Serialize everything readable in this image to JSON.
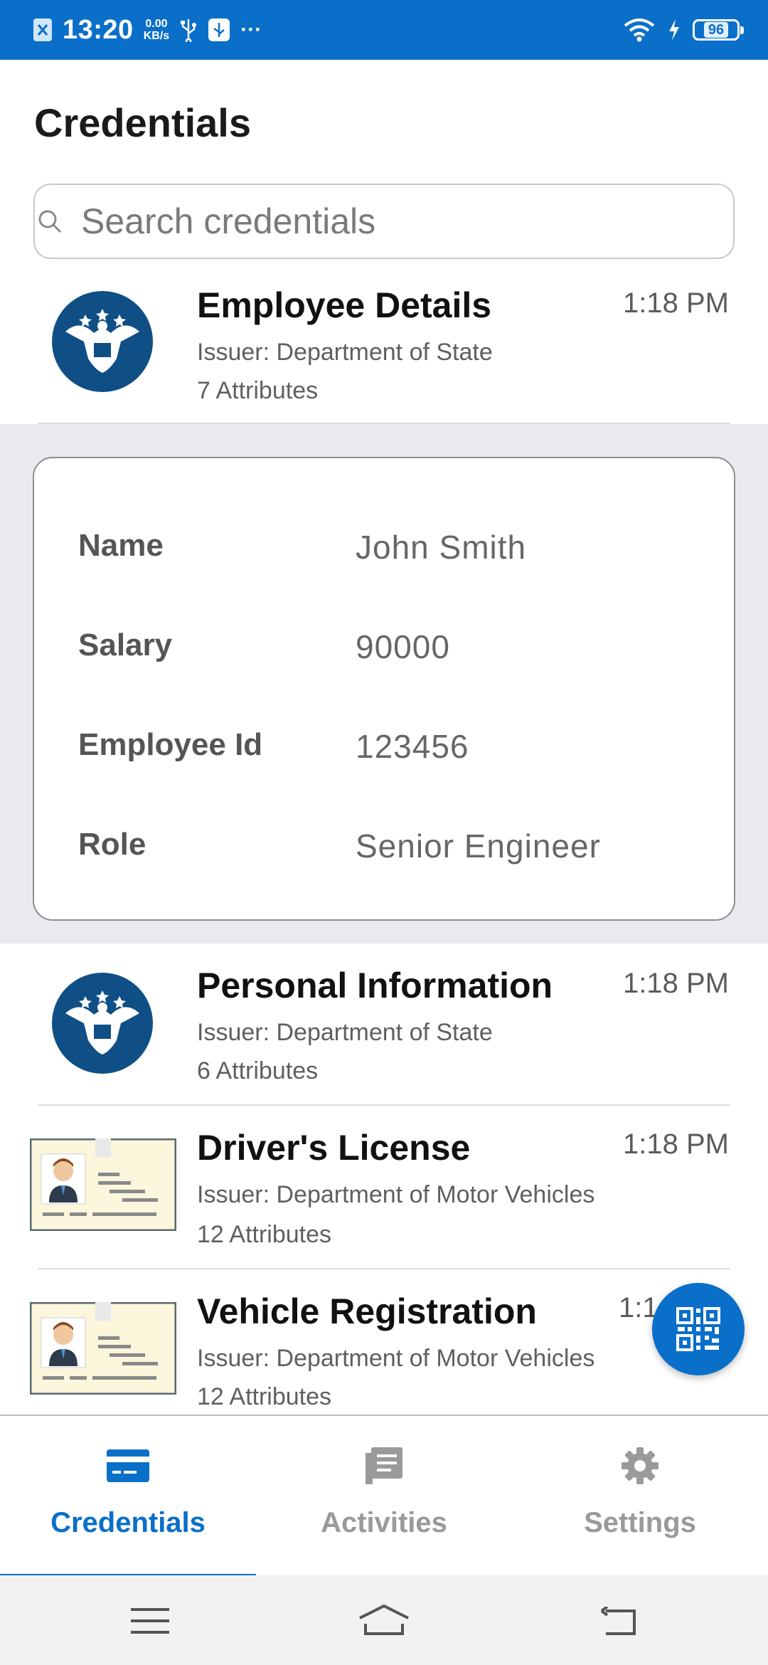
{
  "status_bar": {
    "time": "13:20",
    "speed_value": "0.00",
    "speed_unit": "KB/s",
    "more": "···",
    "battery": "96",
    "color": "#0a6fc8"
  },
  "page": {
    "title": "Credentials",
    "search_placeholder": "Search credentials"
  },
  "credentials": [
    {
      "name": "Employee Details",
      "time": "1:18 PM",
      "issuer": "Issuer: Department of State",
      "attributes": "7 Attributes",
      "logo": "state-department-seal-icon"
    },
    {
      "name": "Personal Information",
      "time": "1:18 PM",
      "issuer": "Issuer: Department of State",
      "attributes": "6 Attributes",
      "logo": "state-department-seal-icon"
    },
    {
      "name": "Driver's License",
      "time": "1:18 PM",
      "issuer": "Issuer: Department of Motor Vehicles",
      "attributes": "12 Attributes",
      "logo": "id-card-icon"
    },
    {
      "name": "Vehicle Registration",
      "time": "1:1",
      "issuer": "Issuer: Department of Motor Vehicles",
      "attributes": "12 Attributes",
      "logo": "id-card-icon"
    }
  ],
  "details": [
    {
      "key": "Name",
      "value": "John Smith"
    },
    {
      "key": "Salary",
      "value": "90000"
    },
    {
      "key": "Employee Id",
      "value": "123456"
    },
    {
      "key": "Role",
      "value": "Senior Engineer"
    }
  ],
  "bottom_nav": {
    "tabs": [
      {
        "label": "Credentials",
        "icon": "credit-card-icon",
        "active": true,
        "color": "#0a6fc8"
      },
      {
        "label": "Activities",
        "icon": "document-list-icon",
        "active": false,
        "color": "#9a9a9a"
      },
      {
        "label": "Settings",
        "icon": "gear-icon",
        "active": false,
        "color": "#9a9a9a"
      }
    ]
  },
  "fab": {
    "icon": "qr-code-icon"
  }
}
